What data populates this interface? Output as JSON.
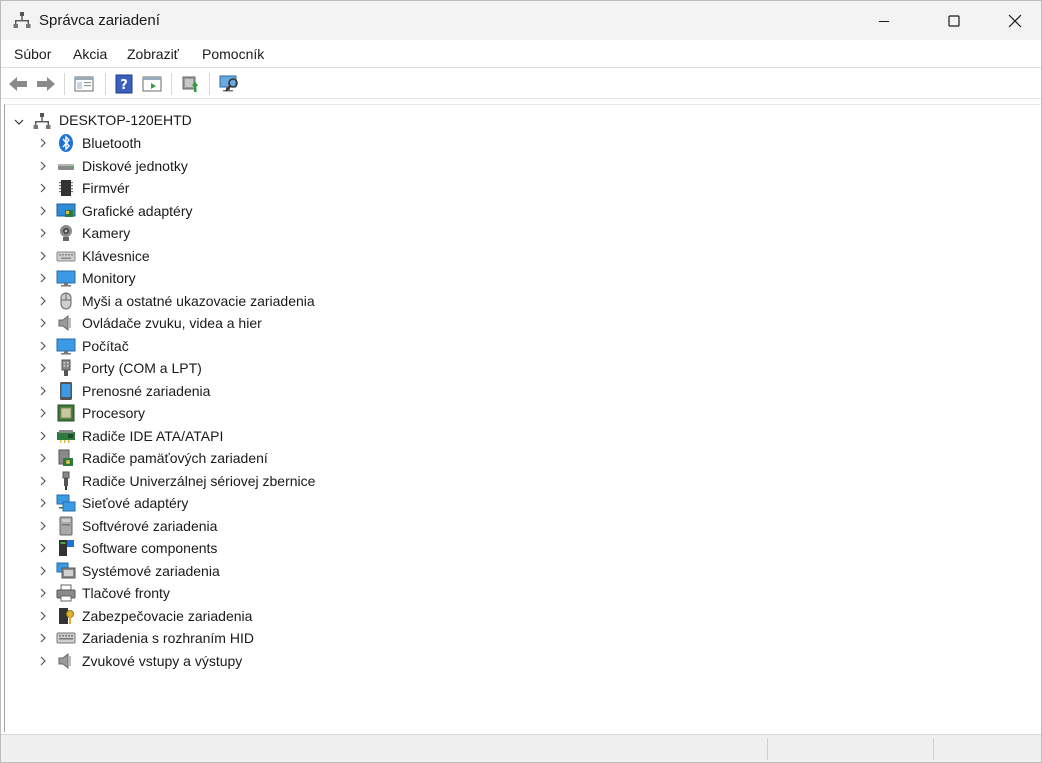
{
  "window": {
    "title": "Správca zariadení"
  },
  "menu": {
    "items": [
      {
        "label": "Súbor"
      },
      {
        "label": "Akcia"
      },
      {
        "label": "Zobraziť"
      },
      {
        "label": "Pomocník"
      }
    ]
  },
  "toolbar": {
    "buttons": [
      "back-arrow-icon",
      "forward-arrow-icon",
      "show-hide-console-tree-icon",
      "help-icon",
      "properties-icon",
      "update-driver-icon",
      "scan-hardware-icon"
    ]
  },
  "tree": {
    "root_label": "DESKTOP-120EHTD",
    "nodes": [
      {
        "label": "Bluetooth",
        "icon": "bluetooth-icon"
      },
      {
        "label": "Diskové jednotky",
        "icon": "disk-drive-icon"
      },
      {
        "label": "Firmvér",
        "icon": "firmware-icon"
      },
      {
        "label": "Grafické adaptéry",
        "icon": "display-adapter-icon"
      },
      {
        "label": "Kamery",
        "icon": "camera-icon"
      },
      {
        "label": "Klávesnice",
        "icon": "keyboard-icon"
      },
      {
        "label": "Monitory",
        "icon": "monitor-icon"
      },
      {
        "label": "Myši a ostatné ukazovacie zariadenia",
        "icon": "mouse-icon"
      },
      {
        "label": "Ovládače zvuku, videa a hier",
        "icon": "speaker-icon"
      },
      {
        "label": "Počítač",
        "icon": "computer-icon"
      },
      {
        "label": "Porty (COM a LPT)",
        "icon": "port-icon"
      },
      {
        "label": "Prenosné zariadenia",
        "icon": "portable-device-icon"
      },
      {
        "label": "Procesory",
        "icon": "processor-icon"
      },
      {
        "label": "Radiče IDE ATA/ATAPI",
        "icon": "ide-controller-icon"
      },
      {
        "label": "Radiče pamäťových zariadení",
        "icon": "storage-controller-icon"
      },
      {
        "label": "Radiče Univerzálnej sériovej zbernice",
        "icon": "usb-icon"
      },
      {
        "label": "Sieťové adaptéry",
        "icon": "network-adapter-icon"
      },
      {
        "label": "Softvérové zariadenia",
        "icon": "software-device-icon"
      },
      {
        "label": "Software components",
        "icon": "software-component-icon"
      },
      {
        "label": "Systémové zariadenia",
        "icon": "system-device-icon"
      },
      {
        "label": "Tlačové fronty",
        "icon": "printer-icon"
      },
      {
        "label": "Zabezpečovacie zariadenia",
        "icon": "security-device-icon"
      },
      {
        "label": "Zariadenia s rozhraním HID",
        "icon": "hid-icon"
      },
      {
        "label": "Zvukové vstupy a výstupy",
        "icon": "audio-io-icon"
      }
    ]
  },
  "colors": {
    "titlebar_bg": "#f3f3f3",
    "accent_blue": "#2a7ad4",
    "statusbar_bg": "#f0f0f0"
  }
}
